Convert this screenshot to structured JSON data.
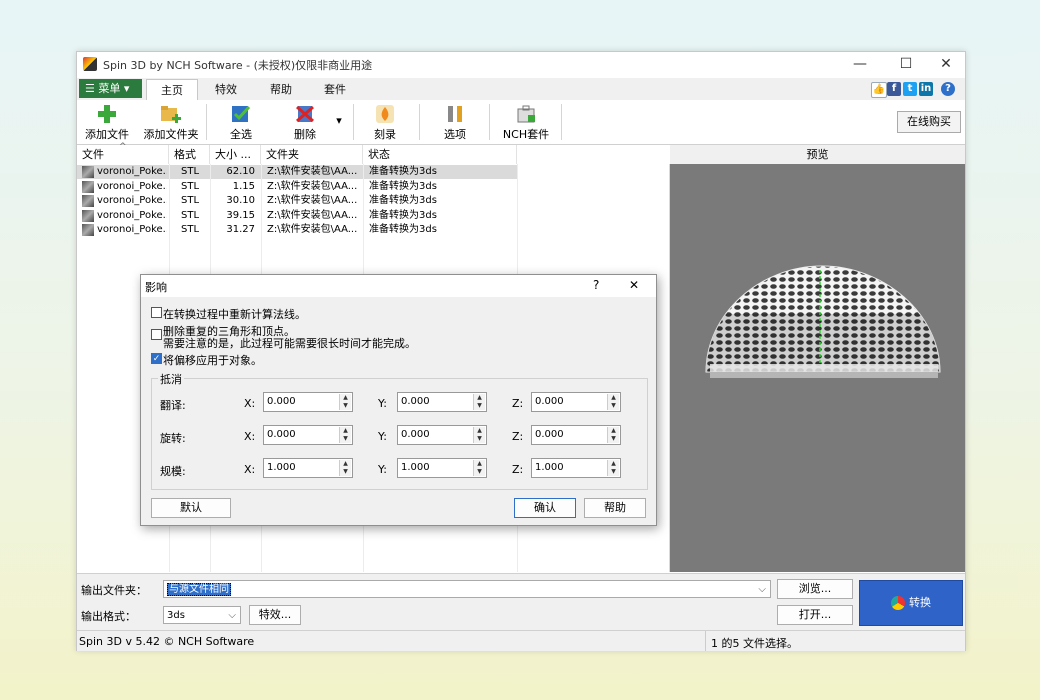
{
  "window": {
    "title": "Spin 3D by NCH Software - (未授权)仅限非商业用途",
    "minimize": "—",
    "maximize": "☐",
    "close": "✕"
  },
  "menubar": {
    "menu_label": "☰ 菜单 ▾",
    "tabs": [
      "主页",
      "特效",
      "帮助",
      "套件"
    ],
    "help_glyph": "?"
  },
  "toolbar": {
    "add_file": "添加文件",
    "add_folder": "添加文件夹",
    "select_all": "全选",
    "delete": "删除",
    "burn": "刻录",
    "options": "选项",
    "nch_suite": "NCH套件",
    "buy_online": "在线购买"
  },
  "file_list": {
    "columns": [
      "文件",
      "格式",
      "大小 ...",
      "文件夹",
      "状态"
    ],
    "rows": [
      {
        "name": "voronoi_Poke...",
        "format": "STL",
        "size": "62.10",
        "folder": "Z:\\软件安装包\\AA...",
        "status": "准备转换为3ds"
      },
      {
        "name": "voronoi_Poke...",
        "format": "STL",
        "size": "1.15",
        "folder": "Z:\\软件安装包\\AA...",
        "status": "准备转换为3ds"
      },
      {
        "name": "voronoi_Poke...",
        "format": "STL",
        "size": "30.10",
        "folder": "Z:\\软件安装包\\AA...",
        "status": "准备转换为3ds"
      },
      {
        "name": "voronoi_Poke...",
        "format": "STL",
        "size": "39.15",
        "folder": "Z:\\软件安装包\\AA...",
        "status": "准备转换为3ds"
      },
      {
        "name": "voronoi_Poke...",
        "format": "STL",
        "size": "31.27",
        "folder": "Z:\\软件安装包\\AA...",
        "status": "准备转换为3ds"
      }
    ]
  },
  "preview": {
    "label": "预览"
  },
  "bottom": {
    "output_folder_label": "输出文件夹：",
    "output_folder_value": "与源文件相同",
    "output_format_label": "输出格式：",
    "output_format_value": "3ds",
    "effects_button": "特效...",
    "browse_button": "浏览...",
    "open_button": "打开...",
    "convert_button": "转换"
  },
  "status_bar": {
    "version": "Spin 3D v 5.42 © NCH Software",
    "selection": "1 的5 文件选择。"
  },
  "dialog": {
    "title": "影响",
    "help": "?",
    "close": "✕",
    "opt_recalc_normals": "在转换过程中重新计算法线。",
    "opt_remove_duplicates": "删除重复的三角形和顶点。",
    "opt_remove_duplicates_note": "需要注意的是，此过程可能需要很长时间才能完成。",
    "opt_apply_offset": "将偏移应用于对象。",
    "opt_recalc_normals_checked": false,
    "opt_remove_duplicates_checked": false,
    "opt_apply_offset_checked": true,
    "group_label": "抵消",
    "row_labels": [
      "翻译:",
      "旋转:",
      "规模:"
    ],
    "axis_x": "X:",
    "axis_y": "Y:",
    "axis_z": "Z:",
    "translate": [
      "0.000",
      "0.000",
      "0.000"
    ],
    "rotate": [
      "0.000",
      "0.000",
      "0.000"
    ],
    "scale": [
      "1.000",
      "1.000",
      "1.000"
    ],
    "default_button": "默认",
    "ok_button": "确认",
    "help_button": "帮助"
  },
  "colors": {
    "menu_green": "#2a7b3d",
    "convert_blue": "#2f63c7",
    "preview_gray": "#7a7a7a",
    "checkbox_blue": "#2e6fc9"
  }
}
